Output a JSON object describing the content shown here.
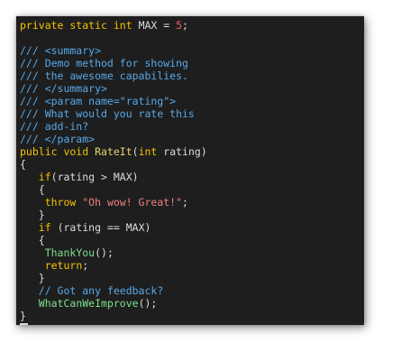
{
  "editor": {
    "lines": [
      [
        [
          "kw",
          "private static int "
        ],
        [
          "id",
          "MAX = "
        ],
        [
          "num",
          "5"
        ],
        [
          "id",
          ";"
        ]
      ],
      [],
      [
        [
          "cm",
          "/// <summary>"
        ]
      ],
      [
        [
          "cm",
          "/// Demo method for showing"
        ]
      ],
      [
        [
          "cm",
          "/// the awesome capabilies."
        ]
      ],
      [
        [
          "cm",
          "/// </summary>"
        ]
      ],
      [
        [
          "cm",
          "/// <param name=\"rating\">"
        ]
      ],
      [
        [
          "cm",
          "/// What would you rate this"
        ]
      ],
      [
        [
          "cm",
          "/// add-in?"
        ]
      ],
      [
        [
          "cm",
          "/// </param>"
        ]
      ],
      [
        [
          "kw",
          "public void "
        ],
        [
          "fn",
          "RateIt"
        ],
        [
          "id",
          "("
        ],
        [
          "kw",
          "int "
        ],
        [
          "id",
          "rating)"
        ]
      ],
      [
        [
          "id",
          "{"
        ]
      ],
      [
        [
          "id",
          "   "
        ],
        [
          "kw",
          "if"
        ],
        [
          "id",
          "(rating > MAX)"
        ]
      ],
      [
        [
          "id",
          "   {"
        ]
      ],
      [
        [
          "id",
          "    "
        ],
        [
          "kw",
          "throw "
        ],
        [
          "str",
          "\"Oh wow! Great!\""
        ],
        [
          "id",
          ";"
        ]
      ],
      [
        [
          "id",
          "   }"
        ]
      ],
      [
        [
          "id",
          "   "
        ],
        [
          "kw",
          "if"
        ],
        [
          "id",
          " (rating == MAX)"
        ]
      ],
      [
        [
          "id",
          "   {"
        ]
      ],
      [
        [
          "id",
          "    "
        ],
        [
          "call",
          "ThankYou"
        ],
        [
          "id",
          "();"
        ]
      ],
      [
        [
          "id",
          "    "
        ],
        [
          "kw",
          "return"
        ],
        [
          "id",
          ";"
        ]
      ],
      [
        [
          "id",
          "   }"
        ]
      ],
      [
        [
          "id",
          "   "
        ],
        [
          "cm",
          "// Got any feedback?"
        ]
      ],
      [
        [
          "id",
          "   "
        ],
        [
          "call",
          "WhatCanWeImprove"
        ],
        [
          "id",
          "();"
        ]
      ],
      [
        [
          "id",
          "}"
        ]
      ]
    ]
  },
  "colors": {
    "background": "#1e1e1e",
    "keyword": "#f5c400",
    "identifier": "#dcdcdc",
    "number": "#f0606a",
    "string": "#f08080",
    "comment": "#57a8e8",
    "method_name": "#e8d56b",
    "method_call": "#7ee08a"
  }
}
